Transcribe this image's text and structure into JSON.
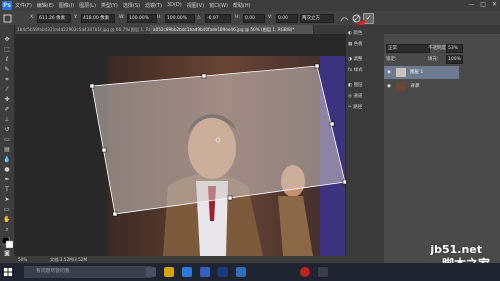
{
  "app": {
    "logo": "Ps",
    "menus": [
      "文件(F)",
      "编辑(E)",
      "图像(I)",
      "图层(L)",
      "类型(Y)",
      "选择(S)",
      "滤镜(T)",
      "3D(D)",
      "视图(V)",
      "窗口(W)",
      "帮助(H)"
    ]
  },
  "window_controls": [
    "—",
    "□",
    "✕"
  ],
  "options": {
    "x_label": "X:",
    "x_value": "611.26 像素",
    "y_label": "Y:",
    "y_value": "418.00 像素",
    "w_label": "W:",
    "w_value": "100.00%",
    "h_label": "H:",
    "h_value": "100.00%",
    "angle_label": "△",
    "angle_value": "-6.97",
    "h_skew_label": "H:",
    "h_skew_value": "0.00",
    "v_skew_label": "V:",
    "v_skew_value": "0.00",
    "interp_value": "两次立方",
    "commit_tooltip": "提交变换 (Enter)"
  },
  "tabs": [
    {
      "label": "1b4c5b58fab4321a4d22902c5a4387b1f.jpg @ 66.7%(图层 1, RGB/8)*",
      "active": false
    },
    {
      "label": "a052c89bb2bdc1bad9b40fade189ee46.jpg @ 50% (图层 1, RGB/8)*",
      "active": true
    }
  ],
  "panels": {
    "color_label": "颜色",
    "swatches_label": "色板",
    "adjust_label": "调整",
    "styles_label": "样式",
    "layers_label": "图层",
    "channels_label": "通道",
    "paths_label": "路径"
  },
  "layers": {
    "blend_mode": "正常",
    "opacity_label": "不透明度:",
    "opacity_value": "53%",
    "lock_label": "锁定:",
    "fill_label": "填充:",
    "fill_value": "100%",
    "items": [
      {
        "name": "图层 1"
      },
      {
        "name": "背景"
      }
    ]
  },
  "status": {
    "zoom": "50%",
    "doc": "文档:3.52M/3.52M"
  },
  "taskbar": {
    "search_placeholder": "有问题尽管问我"
  },
  "watermark": {
    "line1": "jb51.net",
    "line2": "脚本之家"
  },
  "colors": {
    "accent": "#2c6fd6",
    "arrow": "#e02020"
  }
}
